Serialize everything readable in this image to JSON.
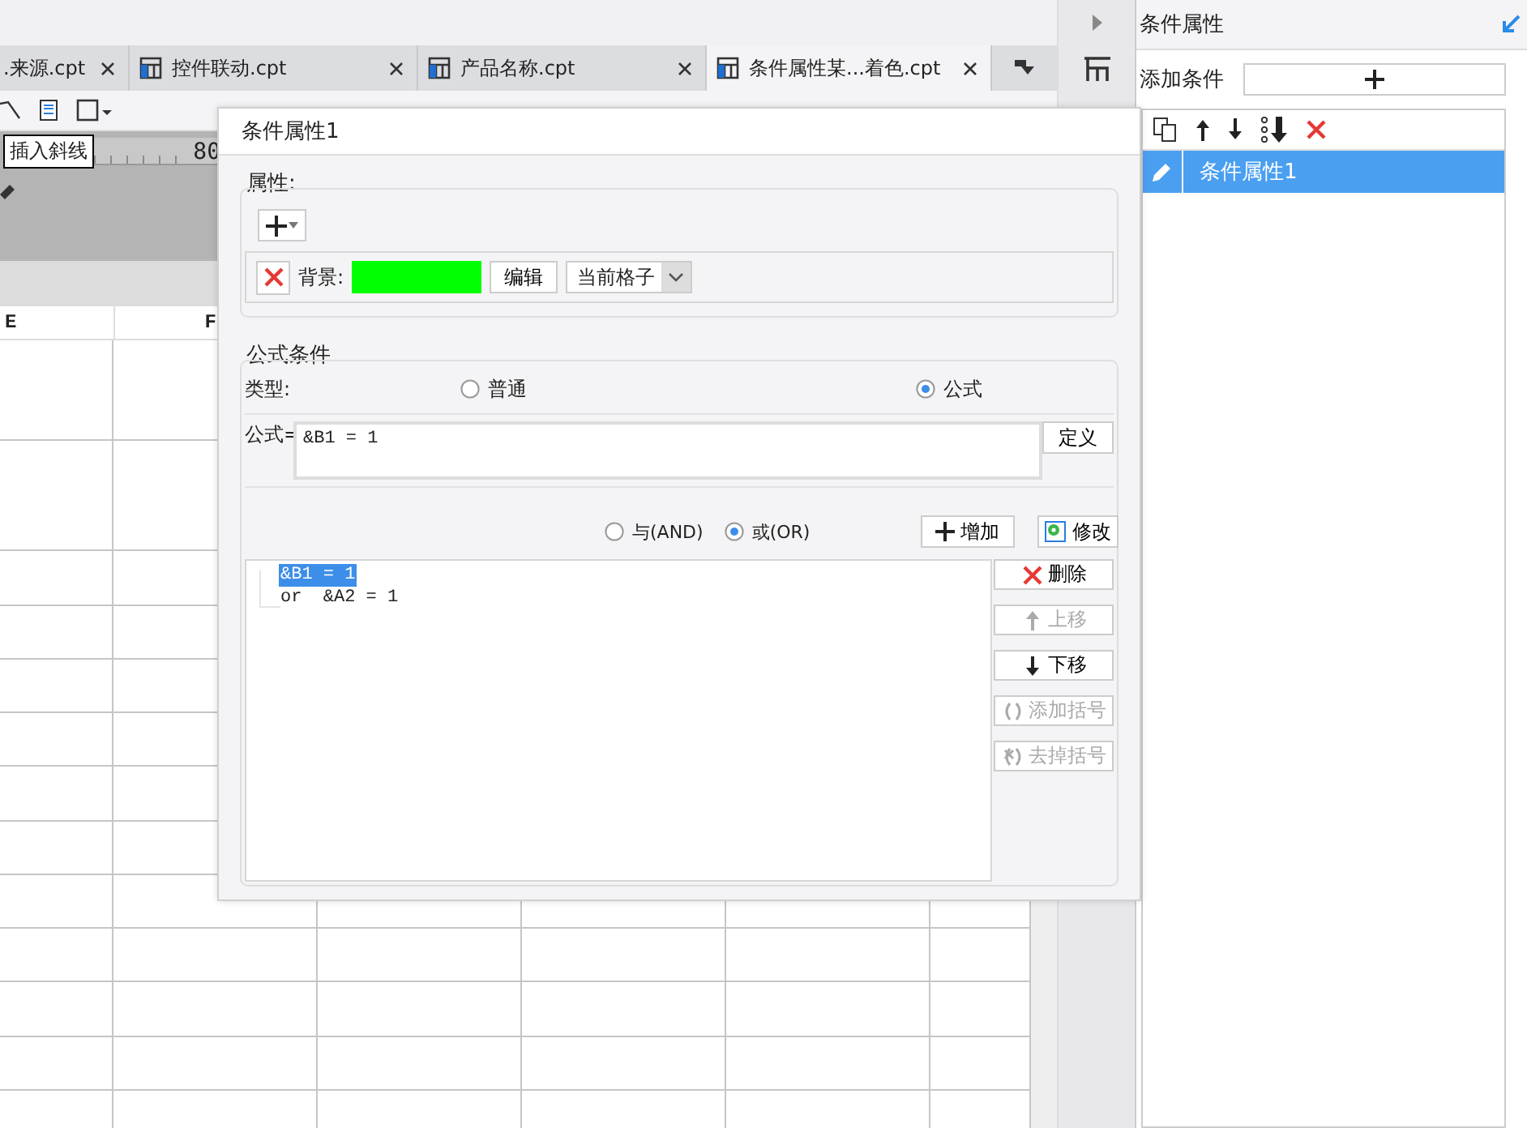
{
  "tabs": [
    {
      "label": ".来源.cpt",
      "icon": false,
      "selected": false
    },
    {
      "label": "控件联动.cpt",
      "icon": true,
      "selected": false
    },
    {
      "label": "产品名称.cpt",
      "icon": true,
      "selected": false
    },
    {
      "label": "条件属性某...着色.cpt",
      "icon": true,
      "selected": true
    }
  ],
  "tooltip": "插入斜线",
  "ruler_label": "80",
  "grid": {
    "columns": [
      "E",
      "F"
    ]
  },
  "dialog": {
    "title": "条件属性1",
    "properties": {
      "legend": "属性:",
      "items": [
        {
          "label": "背景:",
          "color": "#00ff00",
          "edit_button": "编辑",
          "scope": "当前格子"
        }
      ]
    },
    "formula": {
      "legend": "公式条件",
      "type_label": "类型:",
      "types": [
        {
          "label": "普通",
          "selected": false
        },
        {
          "label": "公式",
          "selected": true
        }
      ],
      "formula_label": "公式=",
      "formula_value": "&B1 = 1",
      "define_button": "定义",
      "joins": [
        {
          "label": "与(AND)",
          "selected": false
        },
        {
          "label": "或(OR)",
          "selected": true
        }
      ],
      "add_button": "增加",
      "modify_button": "修改",
      "conditions": [
        {
          "text": "&B1 = 1",
          "selected": true
        },
        {
          "text": "or  &A2 = 1",
          "selected": false
        }
      ],
      "actions": [
        {
          "kind": "delete",
          "label": "删除",
          "disabled": false
        },
        {
          "kind": "up",
          "label": "上移",
          "disabled": true
        },
        {
          "kind": "down",
          "label": "下移",
          "disabled": false
        },
        {
          "kind": "add-paren",
          "label": "添加括号",
          "disabled": true
        },
        {
          "kind": "remove-paren",
          "label": "去掉括号",
          "disabled": true
        }
      ]
    }
  },
  "side_panel": {
    "title": "条件属性",
    "add_label": "添加条件",
    "items": [
      {
        "label": "条件属性1",
        "selected": true
      }
    ]
  }
}
